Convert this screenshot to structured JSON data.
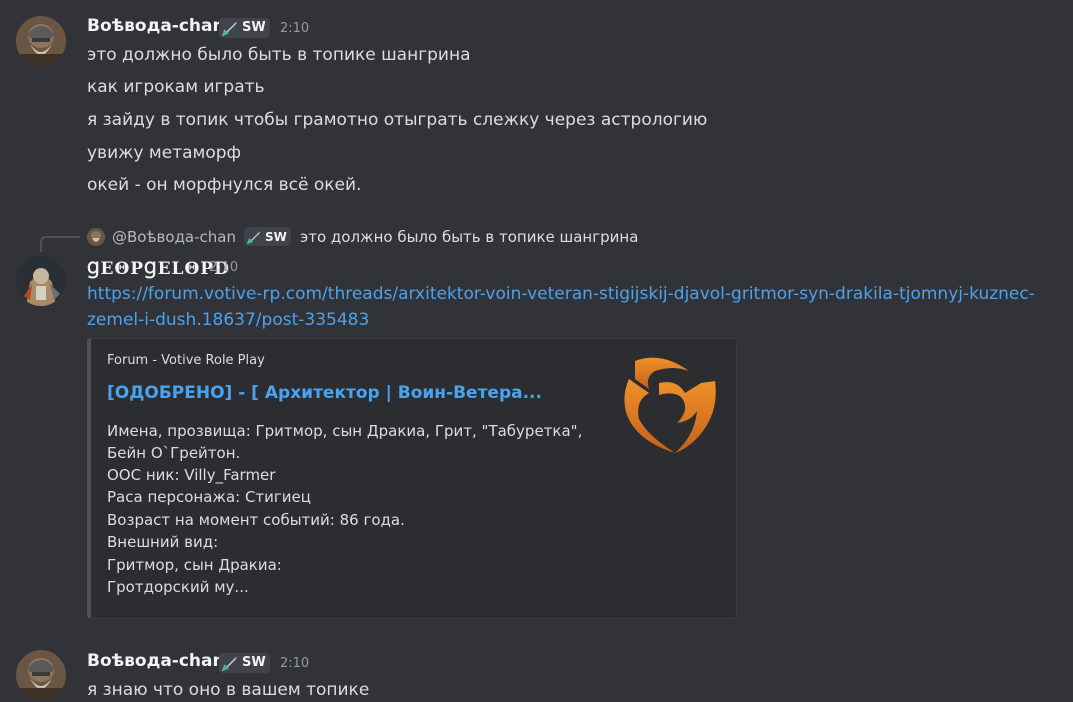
{
  "messages": [
    {
      "author": "Воѣвода-chan",
      "tag": "SW",
      "time": "2:10",
      "lines": [
        "это должно было быть в топике шангрина",
        "как игрокам играть",
        "я зайду в топик чтобы грамотно отыграть слежку через астрологию",
        "увижу метаморф",
        "окей - он морфнулся всё окей."
      ]
    },
    {
      "reply": {
        "author": "@Воѣвода-chan",
        "tag": "SW",
        "text": "это должно было быть в топике шангрина"
      },
      "author": "ꞬΕΘΡꞬΕLΘΡD",
      "time": "2:10",
      "link_lines": [
        "https://forum.votive-rp.com/threads/arxitektor-voin-veteran-stigijskij-djavol-gritmor-syn-drakila-tjomnyj-kuznec-",
        "zemel-i-dush.18637/post-335483"
      ],
      "embed": {
        "provider": "Forum - Votive Role Play",
        "title": "[ОДОБРЕНО] - [ Архитектор | Воин-Ветера...",
        "description": [
          "Имена, прозвища: Гритмор, сын Дракиа, Грит, \"Табуретка\",",
          "Бейн О`Грейтон.",
          "ООС ник: Villy_Farmer",
          "Раса персонажа: Стигиец",
          "Возраст на момент событий: 86 года.",
          "Внешний вид:",
          "Гритмор, сын Дракиа:",
          "Гротдорский му..."
        ],
        "thumbnail_icon": "votive-shield-logo",
        "logo_color": "#d97a1e"
      }
    },
    {
      "author": "Воѣвода-chan",
      "tag": "SW",
      "time": "2:10",
      "lines": [
        "я знаю что оно в вашем топике"
      ]
    }
  ],
  "colors": {
    "background": "#313338",
    "link": "#4aa3f0",
    "embed_bg": "#2b2d31",
    "tag_bg": "#41434a",
    "muted": "#949ba4"
  }
}
